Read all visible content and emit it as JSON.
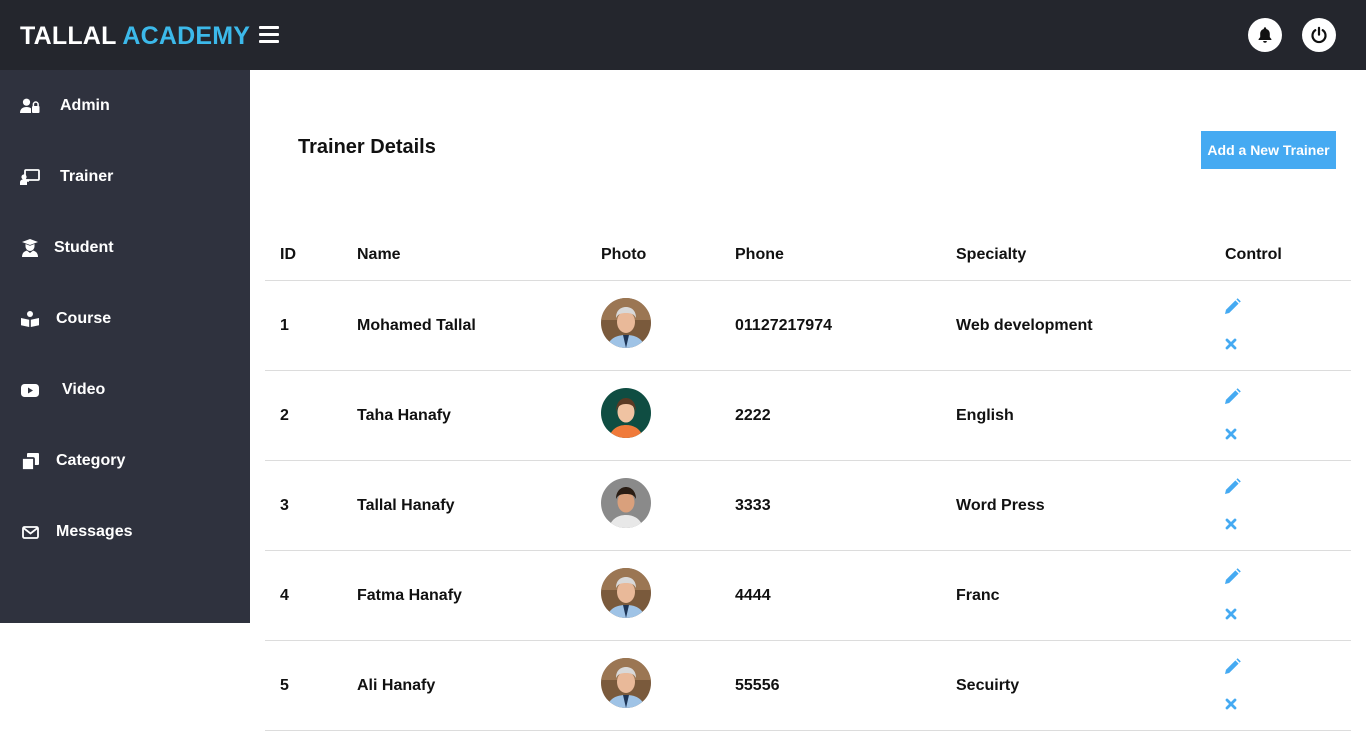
{
  "brand": {
    "part1": "TALLAL",
    "part2": "ACADEMY"
  },
  "colors": {
    "topbar": "#24262d",
    "sidebar": "#2f323e",
    "accent": "#3cb9ea",
    "button": "#45aaf2",
    "icon_blue": "#45aaf2"
  },
  "header": {
    "menu_icon": "hamburger-icon",
    "notification_icon": "bell-icon",
    "logout_icon": "power-icon"
  },
  "sidebar": {
    "items": [
      {
        "label": "Admin",
        "icon": "user-lock-icon"
      },
      {
        "label": "Trainer",
        "icon": "chalkboard-teacher-icon"
      },
      {
        "label": "Student",
        "icon": "graduate-icon"
      },
      {
        "label": "Course",
        "icon": "book-reader-icon"
      },
      {
        "label": "Video",
        "icon": "youtube-icon"
      },
      {
        "label": "Category",
        "icon": "clone-icon"
      },
      {
        "label": "Messages",
        "icon": "envelope-icon"
      }
    ]
  },
  "page": {
    "title": "Trainer Details",
    "add_button": "Add a New Trainer"
  },
  "table": {
    "headers": [
      "ID",
      "Name",
      "Photo",
      "Phone",
      "Specialty",
      "Control"
    ],
    "rows": [
      {
        "id": "1",
        "name": "Mohamed Tallal",
        "phone": "01127217974",
        "specialty": "Web development"
      },
      {
        "id": "2",
        "name": "Taha Hanafy",
        "phone": "2222",
        "specialty": "English"
      },
      {
        "id": "3",
        "name": "Tallal Hanafy",
        "phone": "3333",
        "specialty": "Word Press"
      },
      {
        "id": "4",
        "name": "Fatma Hanafy",
        "phone": "4444",
        "specialty": "Franc"
      },
      {
        "id": "5",
        "name": "Ali Hanafy",
        "phone": "55556",
        "specialty": "Secuirty"
      }
    ]
  }
}
